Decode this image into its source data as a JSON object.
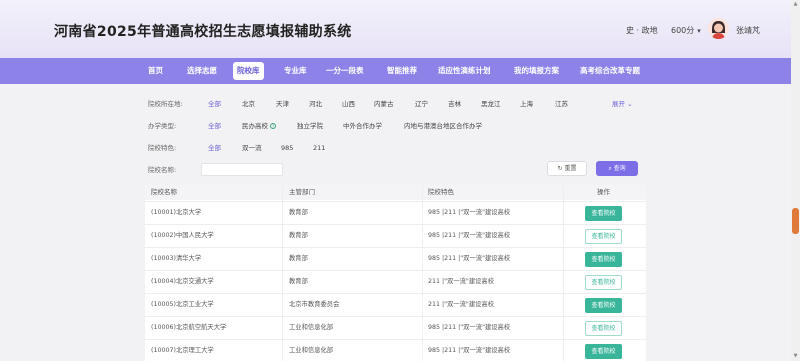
{
  "header": {
    "title": "河南省2025年普通高校招生志愿填报辅助系统",
    "subjects": "史 · 政地",
    "score": "600分",
    "username": "张靖芃"
  },
  "nav": {
    "items": [
      "首页",
      "选择志愿",
      "院校库",
      "专业库",
      "一分一段表",
      "智能推荐",
      "适应性演练计划",
      "我的填报方案",
      "高考综合改革专题"
    ],
    "active_index": 2
  },
  "filters": {
    "location": {
      "label": "院校所在地:",
      "options": [
        "全部",
        "北京",
        "天津",
        "河北",
        "山西",
        "内蒙古",
        "辽宁",
        "吉林",
        "黑龙江",
        "上海",
        "江苏"
      ],
      "expand": "展开"
    },
    "type": {
      "label": "办学类型:",
      "options": [
        "全部",
        "民办高校",
        "独立学院",
        "中外合作办学",
        "内地与港澳台地区合作办学"
      ]
    },
    "feature": {
      "label": "院校特色:",
      "options": [
        "全部",
        "双一流",
        "985",
        "211"
      ]
    },
    "name": {
      "label": "院校名称:",
      "value": ""
    },
    "reset_label": "重置",
    "search_label": "查询"
  },
  "table": {
    "headers": [
      "院校名称",
      "主管部门",
      "院校特色",
      "操作"
    ],
    "rows": [
      {
        "name": "(10001)北京大学",
        "dept": "教育部",
        "feature": "985 |211 |\"双一流\"建设高校",
        "action": "查看院校"
      },
      {
        "name": "(10002)中国人民大学",
        "dept": "教育部",
        "feature": "985 |211 |\"双一流\"建设高校",
        "action": "查看院校"
      },
      {
        "name": "(10003)清华大学",
        "dept": "教育部",
        "feature": "985 |211 |\"双一流\"建设高校",
        "action": "查看院校"
      },
      {
        "name": "(10004)北京交通大学",
        "dept": "教育部",
        "feature": "211 |\"双一流\"建设高校",
        "action": "查看院校"
      },
      {
        "name": "(10005)北京工业大学",
        "dept": "北京市教育委员会",
        "feature": "211 |\"双一流\"建设高校",
        "action": "查看院校"
      },
      {
        "name": "(10006)北京航空航天大学",
        "dept": "工业和信息化部",
        "feature": "985 |211 |\"双一流\"建设高校",
        "action": "查看院校"
      },
      {
        "name": "(10007)北京理工大学",
        "dept": "工业和信息化部",
        "feature": "985 |211 |\"双一流\"建设高校",
        "action": "查看院校"
      }
    ]
  },
  "colors": {
    "nav_bg": "#8c82e8",
    "accent": "#6a5fd8",
    "action_green": "#39b59a"
  }
}
